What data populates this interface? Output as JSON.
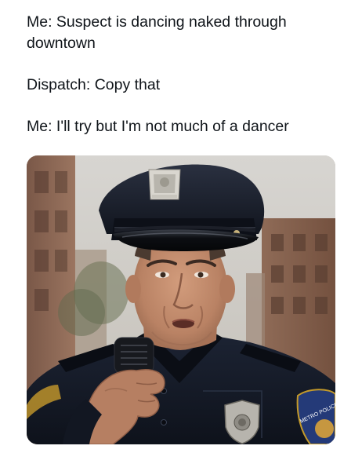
{
  "post": {
    "lines": [
      "Me: Suspect is dancing naked through",
      "downtown",
      "Dispatch: Copy that",
      "Me: I'll try but I'm not much of a dancer"
    ]
  },
  "image": {
    "patch_text": "METRO POLICE",
    "colors": {
      "uniform": "#141a26",
      "skin": "#c08a6e",
      "background_building": "#8a6450",
      "sky": "#d2d0cc"
    }
  }
}
